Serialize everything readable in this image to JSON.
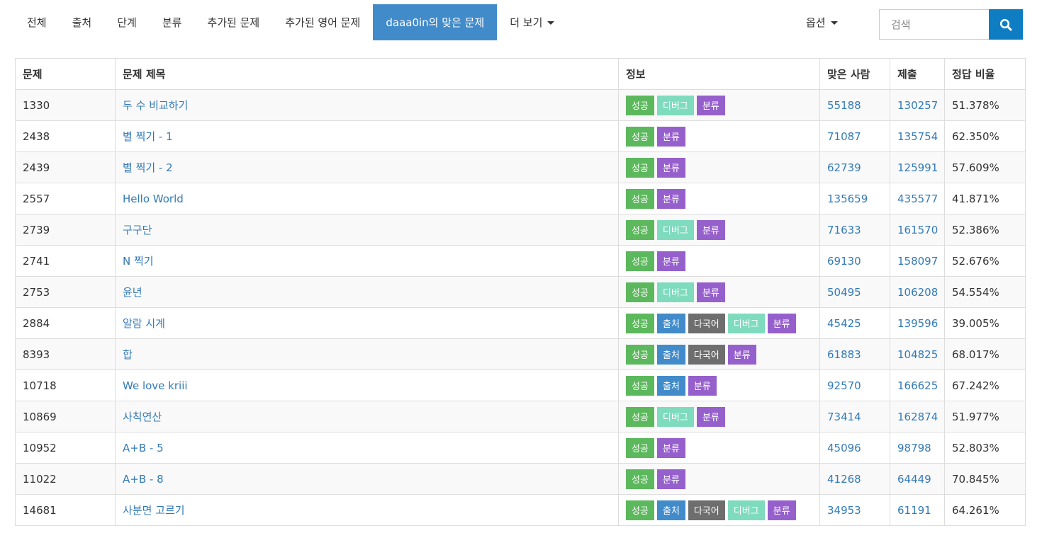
{
  "nav": {
    "tabs": [
      {
        "label": "전체",
        "active": false
      },
      {
        "label": "출처",
        "active": false
      },
      {
        "label": "단계",
        "active": false
      },
      {
        "label": "분류",
        "active": false
      },
      {
        "label": "추가된 문제",
        "active": false
      },
      {
        "label": "추가된 영어 문제",
        "active": false
      },
      {
        "label": "daaa0in의 맞은 문제",
        "active": true
      }
    ],
    "more_label": "더 보기",
    "options_label": "옵션"
  },
  "search": {
    "placeholder": "검색",
    "icon": "search-icon"
  },
  "table": {
    "headers": [
      "문제",
      "문제 제목",
      "정보",
      "맞은 사람",
      "제출",
      "정답 비율"
    ],
    "rows": [
      {
        "id": "1330",
        "title": "두 수 비교하기",
        "tags": [
          "success",
          "debug",
          "class"
        ],
        "correct": "55188",
        "submit": "130257",
        "ratio": "51.378%"
      },
      {
        "id": "2438",
        "title": "별 찍기 - 1",
        "tags": [
          "success",
          "class"
        ],
        "correct": "71087",
        "submit": "135754",
        "ratio": "62.350%"
      },
      {
        "id": "2439",
        "title": "별 찍기 - 2",
        "tags": [
          "success",
          "class"
        ],
        "correct": "62739",
        "submit": "125991",
        "ratio": "57.609%"
      },
      {
        "id": "2557",
        "title": "Hello World",
        "tags": [
          "success",
          "class"
        ],
        "correct": "135659",
        "submit": "435577",
        "ratio": "41.871%"
      },
      {
        "id": "2739",
        "title": "구구단",
        "tags": [
          "success",
          "debug",
          "class"
        ],
        "correct": "71633",
        "submit": "161570",
        "ratio": "52.386%"
      },
      {
        "id": "2741",
        "title": "N 찍기",
        "tags": [
          "success",
          "class"
        ],
        "correct": "69130",
        "submit": "158097",
        "ratio": "52.676%"
      },
      {
        "id": "2753",
        "title": "윤년",
        "tags": [
          "success",
          "debug",
          "class"
        ],
        "correct": "50495",
        "submit": "106208",
        "ratio": "54.554%"
      },
      {
        "id": "2884",
        "title": "알람 시계",
        "tags": [
          "success",
          "source",
          "multi",
          "debug",
          "class"
        ],
        "correct": "45425",
        "submit": "139596",
        "ratio": "39.005%"
      },
      {
        "id": "8393",
        "title": "합",
        "tags": [
          "success",
          "source",
          "multi",
          "class"
        ],
        "correct": "61883",
        "submit": "104825",
        "ratio": "68.017%"
      },
      {
        "id": "10718",
        "title": "We love kriii",
        "tags": [
          "success",
          "source",
          "class"
        ],
        "correct": "92570",
        "submit": "166625",
        "ratio": "67.242%"
      },
      {
        "id": "10869",
        "title": "사칙연산",
        "tags": [
          "success",
          "debug",
          "class"
        ],
        "correct": "73414",
        "submit": "162874",
        "ratio": "51.977%"
      },
      {
        "id": "10952",
        "title": "A+B - 5",
        "tags": [
          "success",
          "class"
        ],
        "correct": "45096",
        "submit": "98798",
        "ratio": "52.803%"
      },
      {
        "id": "11022",
        "title": "A+B - 8",
        "tags": [
          "success",
          "class"
        ],
        "correct": "41268",
        "submit": "64449",
        "ratio": "70.845%"
      },
      {
        "id": "14681",
        "title": "사분면 고르기",
        "tags": [
          "success",
          "source",
          "multi",
          "debug",
          "class"
        ],
        "correct": "34953",
        "submit": "61191",
        "ratio": "64.261%"
      }
    ]
  },
  "badges": {
    "success": {
      "label": "성공",
      "color": "#5cb85c"
    },
    "source": {
      "label": "출처",
      "color": "#428bca"
    },
    "multi": {
      "label": "다국어",
      "color": "#6e6e6e"
    },
    "debug": {
      "label": "디버그",
      "color": "#7fdbbd"
    },
    "class": {
      "label": "분류",
      "color": "#9660cc"
    }
  },
  "colors": {
    "accent": "#428bca",
    "link": "#337ab7",
    "search_button": "#0f7dc2"
  }
}
